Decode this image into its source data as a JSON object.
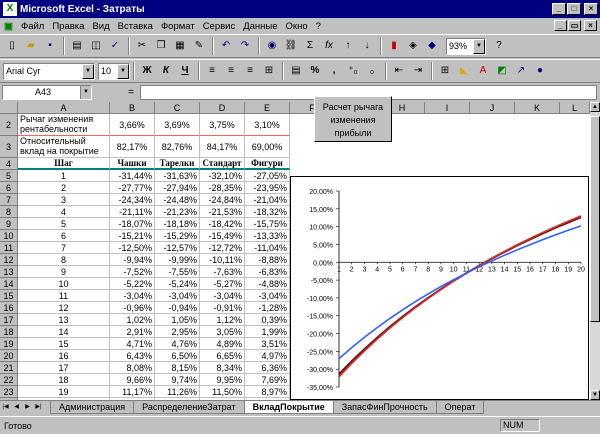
{
  "window": {
    "title": "Microsoft Excel - Затраты",
    "app_icon": "X"
  },
  "menu": [
    "Файл",
    "Правка",
    "Вид",
    "Вставка",
    "Формат",
    "Сервис",
    "Данные",
    "Окно",
    "?"
  ],
  "toolbar": {
    "zoom": "93%",
    "font_name": "Arial Cyr",
    "font_size": "10",
    "bold": "Ж",
    "italic": "К",
    "underline": "Ч",
    "sigma": "Σ",
    "fx": "fx",
    "percent": "%",
    "comma": ","
  },
  "formula_bar": {
    "name_box": "A43",
    "equals": "="
  },
  "columns": [
    "A",
    "B",
    "C",
    "D",
    "E",
    "F",
    "G",
    "H",
    "I",
    "J",
    "K",
    "L"
  ],
  "rows": {
    "r2": {
      "num": "2",
      "a": "Рычаг изменения рентабельности",
      "b": "3,66%",
      "c": "3,69%",
      "d": "3,75%",
      "e": "3,10%"
    },
    "r3": {
      "num": "3",
      "a": "Относительный вклад на покрытие",
      "b": "82,17%",
      "c": "82,76%",
      "d": "84,17%",
      "e": "69,00%"
    },
    "r4": {
      "num": "4",
      "a": "Шаг",
      "b": "Чашки",
      "c": "Тарелки",
      "d": "Стандарт",
      "e": "Фигури"
    }
  },
  "table": [
    [
      "5",
      "1",
      "-31,44%",
      "-31,63%",
      "-32,10%",
      "-27,05%"
    ],
    [
      "6",
      "2",
      "-27,77%",
      "-27,94%",
      "-28,35%",
      "-23,95%"
    ],
    [
      "7",
      "3",
      "-24,34%",
      "-24,48%",
      "-24,84%",
      "-21,04%"
    ],
    [
      "8",
      "4",
      "-21,11%",
      "-21,23%",
      "-21,53%",
      "-18,32%"
    ],
    [
      "9",
      "5",
      "-18,07%",
      "-18,18%",
      "-18,42%",
      "-15,75%"
    ],
    [
      "10",
      "6",
      "-15,21%",
      "-15,29%",
      "-15,49%",
      "-13,33%"
    ],
    [
      "11",
      "7",
      "-12,50%",
      "-12,57%",
      "-12,72%",
      "-11,04%"
    ],
    [
      "12",
      "8",
      "-9,94%",
      "-9,99%",
      "-10,11%",
      "-8,88%"
    ],
    [
      "13",
      "9",
      "-7,52%",
      "-7,55%",
      "-7,63%",
      "-6,83%"
    ],
    [
      "14",
      "10",
      "-5,22%",
      "-5,24%",
      "-5,27%",
      "-4,88%"
    ],
    [
      "15",
      "11",
      "-3,04%",
      "-3,04%",
      "-3,04%",
      "-3,04%"
    ],
    [
      "16",
      "12",
      "-0,96%",
      "-0,94%",
      "-0,91%",
      "-1,28%"
    ],
    [
      "17",
      "13",
      "1,02%",
      "1,05%",
      "1,12%",
      "0,39%"
    ],
    [
      "18",
      "14",
      "2,91%",
      "2,95%",
      "3,05%",
      "1,99%"
    ],
    [
      "19",
      "15",
      "4,71%",
      "4,76%",
      "4,89%",
      "3,51%"
    ],
    [
      "20",
      "16",
      "6,43%",
      "6,50%",
      "6,65%",
      "4,97%"
    ],
    [
      "21",
      "17",
      "8,08%",
      "8,15%",
      "8,34%",
      "6,36%"
    ],
    [
      "22",
      "18",
      "9,66%",
      "9,74%",
      "9,95%",
      "7,69%"
    ],
    [
      "23",
      "19",
      "11,17%",
      "11,26%",
      "11,50%",
      "8,97%"
    ],
    [
      "24",
      "20",
      "12,61%",
      "12,72%",
      "12,98%",
      "10,20%"
    ]
  ],
  "macro_button": "Расчет рычага изменения прибыли",
  "sheets": [
    "Администрация",
    "РаспределениеЗатрат",
    "ВкладПокрытие",
    "ЗапасФинПрочность",
    "Операт"
  ],
  "active_sheet": "ВкладПокрытие",
  "status": {
    "left": "Готово",
    "num": "NUM"
  },
  "chart_data": {
    "type": "line",
    "x": [
      1,
      2,
      3,
      4,
      5,
      6,
      7,
      8,
      9,
      10,
      11,
      12,
      13,
      14,
      15,
      16,
      17,
      18,
      19,
      20
    ],
    "ylim": [
      -0.35,
      0.2
    ],
    "yticks": [
      "20,00%",
      "15,00%",
      "10,00%",
      "5,00%",
      "0,00%",
      "-5,00%",
      "-10,00%",
      "-15,00%",
      "-20,00%",
      "-25,00%",
      "-30,00%",
      "-35,00%"
    ],
    "series": [
      {
        "color": "#000000",
        "values": [
          -0.3144,
          -0.2777,
          -0.2434,
          -0.2111,
          -0.1807,
          -0.1521,
          -0.125,
          -0.0994,
          -0.0752,
          -0.0522,
          -0.0304,
          -0.0096,
          0.0102,
          0.0291,
          0.0471,
          0.0643,
          0.0808,
          0.0966,
          0.1117,
          0.1261
        ]
      },
      {
        "color": "#a00000",
        "values": [
          -0.3163,
          -0.2794,
          -0.2448,
          -0.2123,
          -0.1818,
          -0.1529,
          -0.1257,
          -0.0999,
          -0.0755,
          -0.0524,
          -0.0304,
          -0.0094,
          0.0105,
          0.0295,
          0.0476,
          0.065,
          0.0815,
          0.0974,
          0.1126,
          0.1272
        ]
      },
      {
        "color": "#c03030",
        "values": [
          -0.321,
          -0.2835,
          -0.2484,
          -0.2153,
          -0.1842,
          -0.1549,
          -0.1272,
          -0.1011,
          -0.0763,
          -0.0527,
          -0.0304,
          -0.0091,
          0.0112,
          0.0305,
          0.0489,
          0.0665,
          0.0834,
          0.0995,
          0.115,
          0.1298
        ]
      },
      {
        "color": "#3060ff",
        "values": [
          -0.2705,
          -0.2395,
          -0.2104,
          -0.1832,
          -0.1575,
          -0.1333,
          -0.1104,
          -0.0888,
          -0.0683,
          -0.0488,
          -0.0304,
          -0.0128,
          0.0039,
          0.0199,
          0.0351,
          0.0497,
          0.0636,
          0.0769,
          0.0897,
          0.102
        ]
      }
    ]
  }
}
